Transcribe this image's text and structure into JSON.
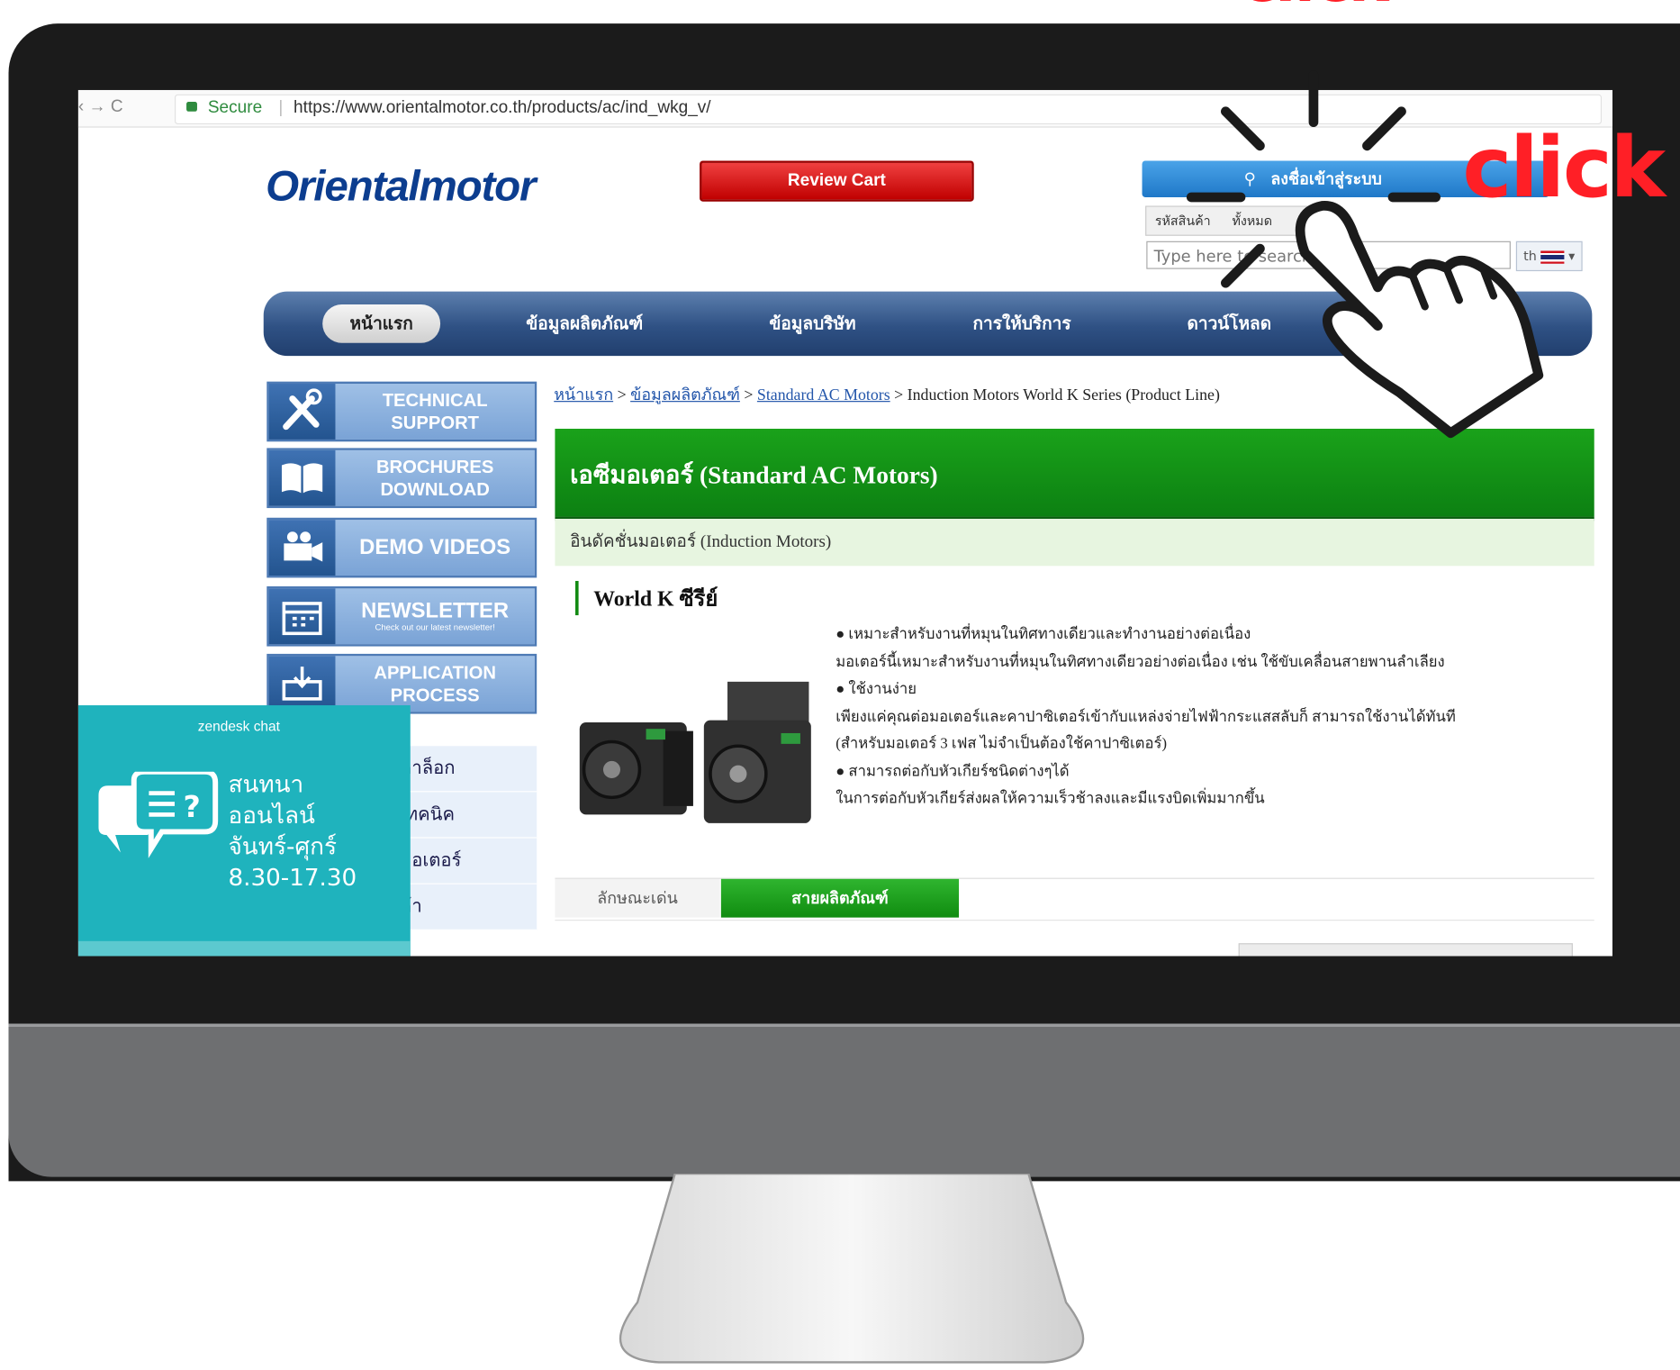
{
  "browser": {
    "nav_glyphs": "‹  →   C",
    "secure_label": "Secure",
    "separator": "|",
    "url": "https://www.orientalmotor.co.th/products/ac/ind_wkg_v/"
  },
  "header": {
    "logo_text": "Orientalmotor",
    "cart_label": "Review Cart",
    "login_label": "ลงชื่อเข้าสู่ระบบ",
    "search_tabs": [
      "รหัสสินค้า",
      "ทั้งหมด"
    ],
    "search_placeholder": "Type here to search",
    "lang_code": "th"
  },
  "nav": {
    "items": [
      "หน้าแรก",
      "ข้อมูลผลิตภัณฑ์",
      "ข้อมูลบริษัท",
      "การให้บริการ",
      "ดาวน์โหลด"
    ]
  },
  "sidebar": {
    "buttons": [
      {
        "line1": "TECHNICAL",
        "line2": "SUPPORT",
        "icon": "tools-icon"
      },
      {
        "line1": "BROCHURES",
        "line2": "DOWNLOAD",
        "icon": "book-icon"
      },
      {
        "line1": "DEMO VIDEOS",
        "icon": "video-camera-icon"
      },
      {
        "line1": "NEWSLETTER",
        "sub": "Check out our latest newsletter!",
        "icon": "calendar-icon"
      },
      {
        "line1": "APPLICATION",
        "line2": "PROCESS",
        "icon": "process-icon"
      }
    ],
    "list": [
      "คาล็อก",
      "เทคนิค",
      "มอเตอร์",
      "ค้า"
    ]
  },
  "chat": {
    "brand": "zendesk chat",
    "lines": [
      "สนทนา",
      "ออนไลน์",
      "จันทร์-ศุกร์",
      "8.30-17.30"
    ]
  },
  "content": {
    "breadcrumb": {
      "links": [
        "หน้าแรก",
        "ข้อมูลผลิตภัณฑ์",
        "Standard AC Motors"
      ],
      "separator": " > ",
      "current": "Induction Motors World K Series (Product Line)"
    },
    "title": "เอซีมอเตอร์ (Standard AC Motors)",
    "subtitle": "อินดัคชั่นมอเตอร์ (Induction Motors)",
    "series": "World K ซีรีย์",
    "description": [
      "● เหมาะสำหรับงานที่หมุนในทิศทางเดียวและทำงานอย่างต่อเนื่อง",
      "มอเตอร์นี้เหมาะสำหรับงานที่หมุนในทิศทางเดียวอย่างต่อเนื่อง เช่น ใช้ขับเคลื่อนสายพานลำเลียง",
      "● ใช้งานง่าย",
      "เพียงแค่คุณต่อมอเตอร์และคาปาซิเตอร์เข้ากับแหล่งจ่ายไฟฟ้ากระแสสลับก็ สามารถใช้งานได้ทันที",
      "(สำหรับมอเตอร์ 3 เฟส ไม่จำเป็นต้องใช้คาปาซิเตอร์)",
      "● สามารถต่อกับหัวเกียร์ชนิดต่างๆได้",
      "ในการต่อกับหัวเกียร์ส่งผลให้ความเร็วช้าลงและมีแรงบิดเพิ่มมากขึ้น"
    ],
    "tabs": [
      "ลักษณะเด่น",
      "สายผลิตภัณฑ์"
    ]
  },
  "annotation": {
    "click_top": "click",
    "click_right": "click",
    "color": "#ff1f26"
  },
  "colors": {
    "brand_blue": "#0c3d8f",
    "nav_blue": "#2f5184",
    "title_green": "#129a14",
    "chat_teal": "#1fb3bd"
  }
}
